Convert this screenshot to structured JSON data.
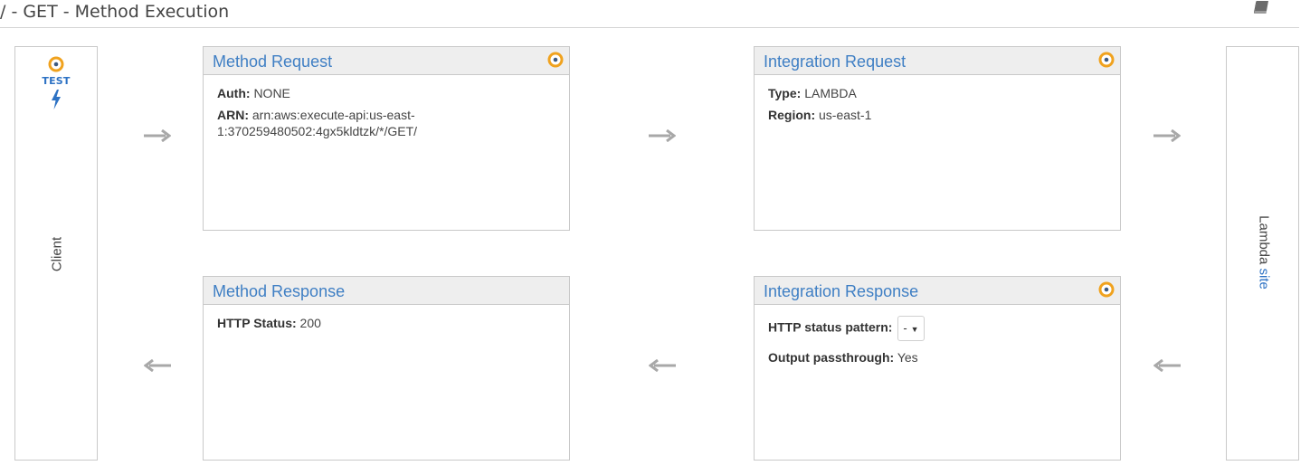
{
  "header": {
    "title": "/ - GET - Method Execution",
    "book_icon": "book-icon"
  },
  "client": {
    "test_label": "TEST",
    "label": "Client",
    "icons": [
      "target-icon",
      "lightning-icon"
    ]
  },
  "lambda": {
    "label_prefix": "Lambda ",
    "label_link": "site"
  },
  "method_request": {
    "title": "Method Request",
    "auth_label": "Auth:",
    "auth_value": "NONE",
    "arn_label": "ARN:",
    "arn_value": "arn:aws:execute-api:us-east-1:370259480502:4gx5kldtzk/*/GET/"
  },
  "integration_request": {
    "title": "Integration Request",
    "type_label": "Type:",
    "type_value": "LAMBDA",
    "region_label": "Region:",
    "region_value": "us-east-1"
  },
  "method_response": {
    "title": "Method Response",
    "status_label": "HTTP Status:",
    "status_value": "200"
  },
  "integration_response": {
    "title": "Integration Response",
    "pattern_label": "HTTP status pattern:",
    "pattern_selected": "-",
    "passthrough_label": "Output passthrough:",
    "passthrough_value": "Yes"
  },
  "colors": {
    "accent_link": "#3f7fc4",
    "indicator_orange": "#f0a21e",
    "indicator_center": "#3d5a80",
    "arrow_gray": "#a8a8a8",
    "border": "#c9c9c9",
    "panel_header_bg": "#eeeeee"
  }
}
